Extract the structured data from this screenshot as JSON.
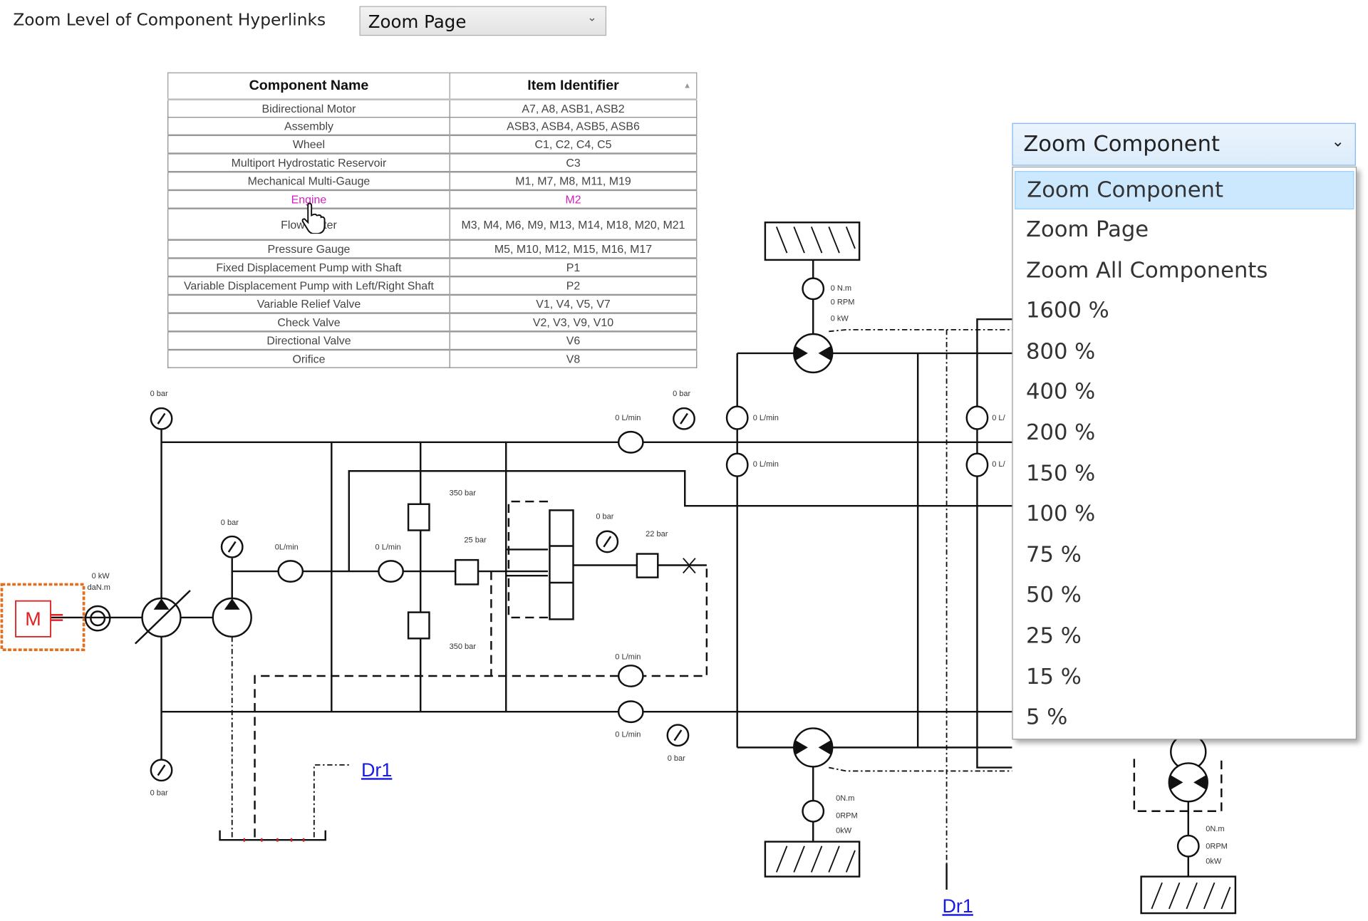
{
  "header": {
    "label": "Zoom Level of Component Hyperlinks",
    "select_value": "Zoom Page"
  },
  "table": {
    "columns": [
      "Component Name",
      "Item Identifier"
    ],
    "rows": [
      [
        "Bidirectional Motor",
        "A7, A8, ASB1, ASB2"
      ],
      [
        "Assembly",
        "ASB3, ASB4, ASB5, ASB6"
      ],
      [
        "Wheel",
        "C1, C2, C4, C5"
      ],
      [
        "Multiport Hydrostatic Reservoir",
        "C3"
      ],
      [
        "Mechanical Multi-Gauge",
        "M1, M7, M8, M11, M19"
      ],
      [
        "Engine",
        "M2"
      ],
      [
        "Flow Meter",
        "M3, M4, M6, M9, M13, M14, M18, M20, M21"
      ],
      [
        "Pressure Gauge",
        "M5, M10, M12, M15, M16, M17"
      ],
      [
        "Fixed Displacement Pump with Shaft",
        "P1"
      ],
      [
        "Variable Displacement Pump with Left/Right Shaft",
        "P2"
      ],
      [
        "Variable Relief Valve",
        "V1, V4, V5, V7"
      ],
      [
        "Check Valve",
        "V2, V3, V9, V10"
      ],
      [
        "Directional Valve",
        "V6"
      ],
      [
        "Orifice",
        "V8"
      ]
    ],
    "hover_row": "Engine",
    "hover_color": "#d020c0"
  },
  "zoom_dropdown": {
    "value": "Zoom Component",
    "options": [
      "Zoom Component",
      "Zoom Page",
      "Zoom All Components",
      "1600 %",
      "800 %",
      "400 %",
      "200 %",
      "150 %",
      "100 %",
      "75 %",
      "50 %",
      "25 %",
      "15 %",
      "5 %"
    ],
    "highlighted": "Zoom Component"
  },
  "diagram": {
    "engine_label": "M",
    "engine_color": "#e02020",
    "selection_color": "#e07020",
    "labels": {
      "p_top_left": "0 bar",
      "p_bot_left": "0 bar",
      "p_pump": "0 bar",
      "flow_pump": "0L/min",
      "flow_mid": "0 L/min",
      "relief_top": "350 bar",
      "relief_bot": "350 bar",
      "valve_25": "25 bar",
      "p_dv": "0 bar",
      "relief_22": "22 bar",
      "flow_top": "0 L/min",
      "p_top": "0 bar",
      "flow_return": "0 L/min",
      "flow_bot": "0 L/min",
      "p_bot": "0 bar",
      "flow_r1": "0 L/min",
      "flow_r2": "0 L/min",
      "flow_r3": "0 L/",
      "flow_r4": "0 L/",
      "eng_kw": "0 kW",
      "eng_torque": "daN.m",
      "g1_torque": "0 N.m",
      "g1_rpm": "0 RPM",
      "g1_kw": "0 kW",
      "g2_torque": "0N.m",
      "g2_rpm": "0RPM",
      "g2_kw": "0kW",
      "g3_torque": "0N.m",
      "g3_rpm": "0RPM",
      "g3_kw": "0kW"
    },
    "links": [
      "Dr1",
      "Dr1"
    ]
  }
}
